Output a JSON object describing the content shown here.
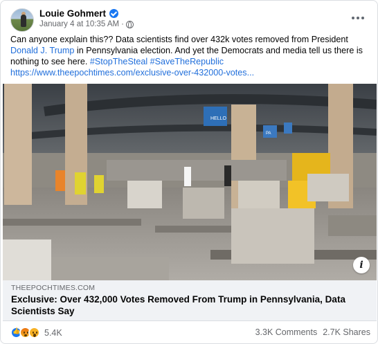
{
  "post": {
    "author": "Louie Gohmert",
    "date": "January 4 at 10:35 AM",
    "meta_separator": "·",
    "text_intro": "Can anyone explain this?? Data scientists find over 432k votes removed from President ",
    "mention": "Donald J. Trump",
    "text_middle": " in Pennsylvania election. And yet the Democrats and media tell us there is nothing to see here. ",
    "hashtags": [
      "#StopTheSteal",
      "#SaveTheRepublic"
    ],
    "url": "https://www.theepochtimes.com/exclusive-over-432000-votes..."
  },
  "link_preview": {
    "domain": "THEEPOCHTIMES.COM",
    "headline": "Exclusive: Over 432,000 Votes Removed From Trump in Pennsylvania, Data Scientists Say",
    "info_glyph": "i"
  },
  "photo": {
    "banner_text": [
      "HELLO",
      "PA"
    ]
  },
  "engagement": {
    "reactions": [
      "like",
      "angry",
      "wow"
    ],
    "reaction_count": "5.4K",
    "comments": "3.3K Comments",
    "shares": "2.7K Shares"
  },
  "colors": {
    "link": "#216fdb",
    "muted": "#65676b",
    "link_preview_bg": "#f0f2f5",
    "verified": "#1877f2"
  }
}
